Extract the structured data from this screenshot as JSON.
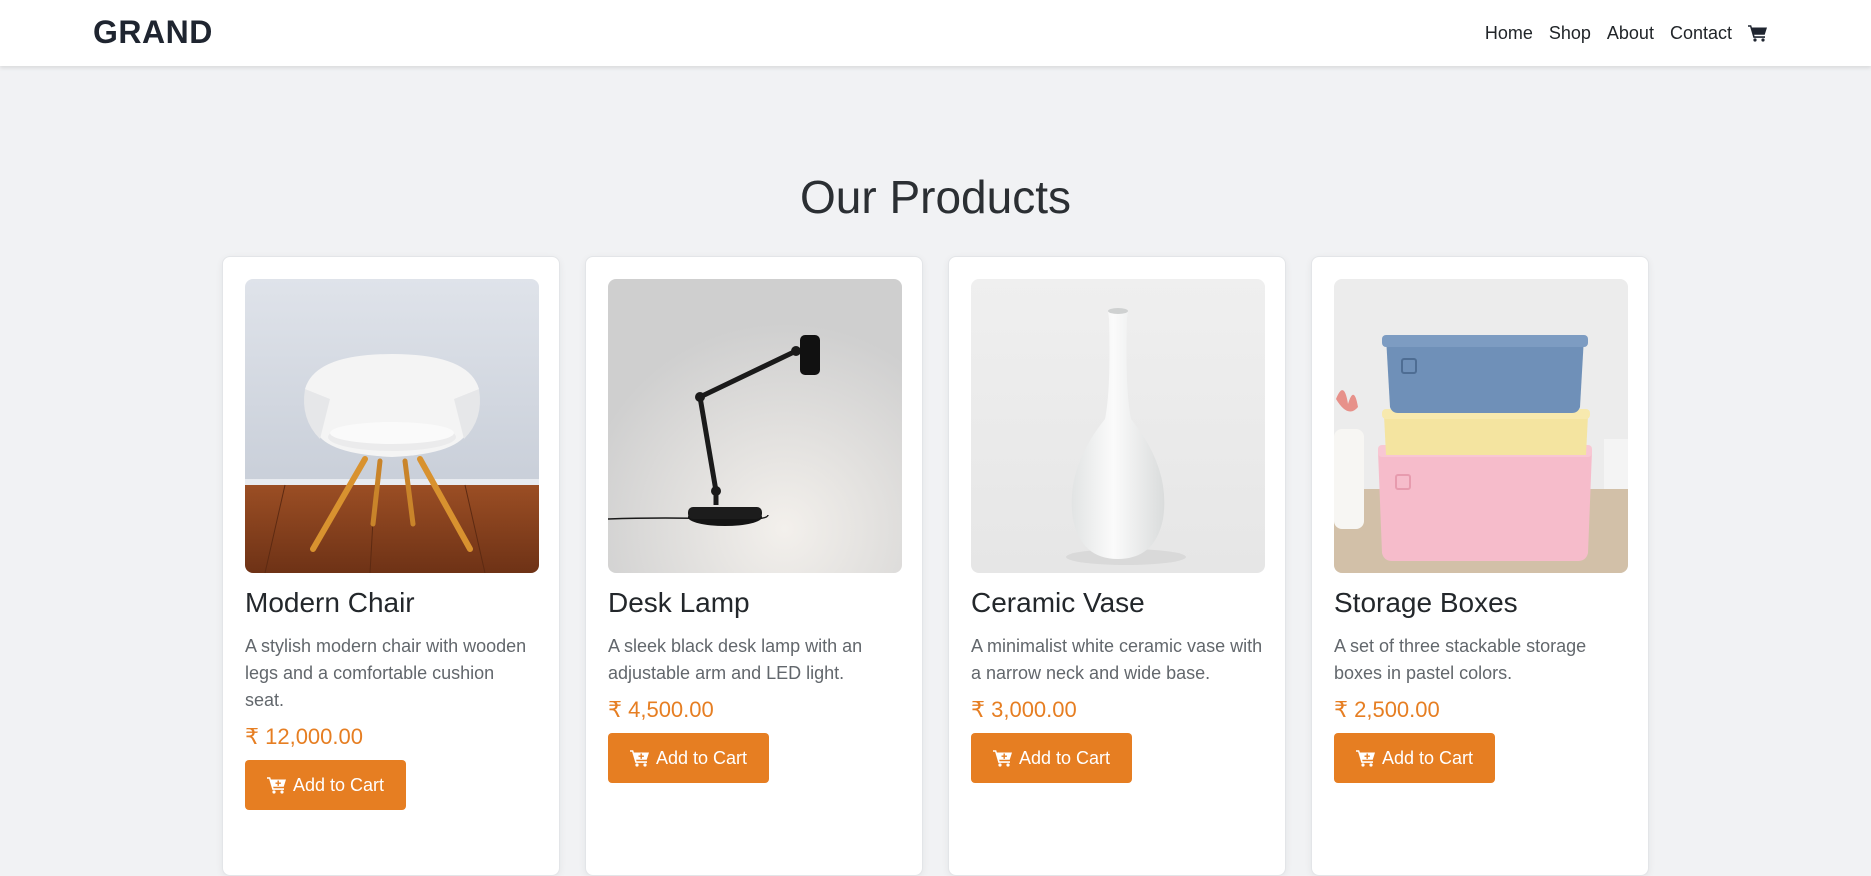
{
  "brand": "GRAND",
  "nav": {
    "links": [
      "Home",
      "Shop",
      "About",
      "Contact"
    ],
    "cart_icon": "shopping-cart-icon"
  },
  "colors": {
    "accent": "#e67e22",
    "background": "#f1f2f4",
    "card": "#ffffff",
    "text": "#212529",
    "muted": "#62676c"
  },
  "page": {
    "title": "Our Products"
  },
  "products": [
    {
      "name": "Modern Chair",
      "description": "A stylish modern chair with wooden legs and a comfortable cushion seat.",
      "price": "₹ 12,000.00",
      "button": "Add to Cart",
      "image": "white-chair-photo"
    },
    {
      "name": "Desk Lamp",
      "description": "A sleek black desk lamp with an adjustable arm and LED light.",
      "price": "₹ 4,500.00",
      "button": "Add to Cart",
      "image": "black-desk-lamp-photo"
    },
    {
      "name": "Ceramic Vase",
      "description": "A minimalist white ceramic vase with a narrow neck and wide base.",
      "price": "₹ 3,000.00",
      "button": "Add to Cart",
      "image": "white-vase-photo"
    },
    {
      "name": "Storage Boxes",
      "description": "A set of three stackable storage boxes in pastel colors.",
      "price": "₹ 2,500.00",
      "button": "Add to Cart",
      "image": "pastel-boxes-photo"
    }
  ]
}
